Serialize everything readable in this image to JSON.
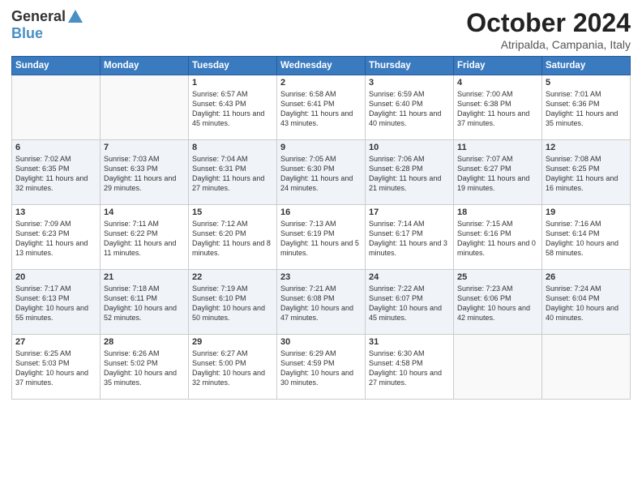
{
  "header": {
    "logo_line1": "General",
    "logo_line2": "Blue",
    "month": "October 2024",
    "location": "Atripalda, Campania, Italy"
  },
  "days_of_week": [
    "Sunday",
    "Monday",
    "Tuesday",
    "Wednesday",
    "Thursday",
    "Friday",
    "Saturday"
  ],
  "weeks": [
    [
      {
        "day": "",
        "content": ""
      },
      {
        "day": "",
        "content": ""
      },
      {
        "day": "1",
        "content": "Sunrise: 6:57 AM\nSunset: 6:43 PM\nDaylight: 11 hours and 45 minutes."
      },
      {
        "day": "2",
        "content": "Sunrise: 6:58 AM\nSunset: 6:41 PM\nDaylight: 11 hours and 43 minutes."
      },
      {
        "day": "3",
        "content": "Sunrise: 6:59 AM\nSunset: 6:40 PM\nDaylight: 11 hours and 40 minutes."
      },
      {
        "day": "4",
        "content": "Sunrise: 7:00 AM\nSunset: 6:38 PM\nDaylight: 11 hours and 37 minutes."
      },
      {
        "day": "5",
        "content": "Sunrise: 7:01 AM\nSunset: 6:36 PM\nDaylight: 11 hours and 35 minutes."
      }
    ],
    [
      {
        "day": "6",
        "content": "Sunrise: 7:02 AM\nSunset: 6:35 PM\nDaylight: 11 hours and 32 minutes."
      },
      {
        "day": "7",
        "content": "Sunrise: 7:03 AM\nSunset: 6:33 PM\nDaylight: 11 hours and 29 minutes."
      },
      {
        "day": "8",
        "content": "Sunrise: 7:04 AM\nSunset: 6:31 PM\nDaylight: 11 hours and 27 minutes."
      },
      {
        "day": "9",
        "content": "Sunrise: 7:05 AM\nSunset: 6:30 PM\nDaylight: 11 hours and 24 minutes."
      },
      {
        "day": "10",
        "content": "Sunrise: 7:06 AM\nSunset: 6:28 PM\nDaylight: 11 hours and 21 minutes."
      },
      {
        "day": "11",
        "content": "Sunrise: 7:07 AM\nSunset: 6:27 PM\nDaylight: 11 hours and 19 minutes."
      },
      {
        "day": "12",
        "content": "Sunrise: 7:08 AM\nSunset: 6:25 PM\nDaylight: 11 hours and 16 minutes."
      }
    ],
    [
      {
        "day": "13",
        "content": "Sunrise: 7:09 AM\nSunset: 6:23 PM\nDaylight: 11 hours and 13 minutes."
      },
      {
        "day": "14",
        "content": "Sunrise: 7:11 AM\nSunset: 6:22 PM\nDaylight: 11 hours and 11 minutes."
      },
      {
        "day": "15",
        "content": "Sunrise: 7:12 AM\nSunset: 6:20 PM\nDaylight: 11 hours and 8 minutes."
      },
      {
        "day": "16",
        "content": "Sunrise: 7:13 AM\nSunset: 6:19 PM\nDaylight: 11 hours and 5 minutes."
      },
      {
        "day": "17",
        "content": "Sunrise: 7:14 AM\nSunset: 6:17 PM\nDaylight: 11 hours and 3 minutes."
      },
      {
        "day": "18",
        "content": "Sunrise: 7:15 AM\nSunset: 6:16 PM\nDaylight: 11 hours and 0 minutes."
      },
      {
        "day": "19",
        "content": "Sunrise: 7:16 AM\nSunset: 6:14 PM\nDaylight: 10 hours and 58 minutes."
      }
    ],
    [
      {
        "day": "20",
        "content": "Sunrise: 7:17 AM\nSunset: 6:13 PM\nDaylight: 10 hours and 55 minutes."
      },
      {
        "day": "21",
        "content": "Sunrise: 7:18 AM\nSunset: 6:11 PM\nDaylight: 10 hours and 52 minutes."
      },
      {
        "day": "22",
        "content": "Sunrise: 7:19 AM\nSunset: 6:10 PM\nDaylight: 10 hours and 50 minutes."
      },
      {
        "day": "23",
        "content": "Sunrise: 7:21 AM\nSunset: 6:08 PM\nDaylight: 10 hours and 47 minutes."
      },
      {
        "day": "24",
        "content": "Sunrise: 7:22 AM\nSunset: 6:07 PM\nDaylight: 10 hours and 45 minutes."
      },
      {
        "day": "25",
        "content": "Sunrise: 7:23 AM\nSunset: 6:06 PM\nDaylight: 10 hours and 42 minutes."
      },
      {
        "day": "26",
        "content": "Sunrise: 7:24 AM\nSunset: 6:04 PM\nDaylight: 10 hours and 40 minutes."
      }
    ],
    [
      {
        "day": "27",
        "content": "Sunrise: 6:25 AM\nSunset: 5:03 PM\nDaylight: 10 hours and 37 minutes."
      },
      {
        "day": "28",
        "content": "Sunrise: 6:26 AM\nSunset: 5:02 PM\nDaylight: 10 hours and 35 minutes."
      },
      {
        "day": "29",
        "content": "Sunrise: 6:27 AM\nSunset: 5:00 PM\nDaylight: 10 hours and 32 minutes."
      },
      {
        "day": "30",
        "content": "Sunrise: 6:29 AM\nSunset: 4:59 PM\nDaylight: 10 hours and 30 minutes."
      },
      {
        "day": "31",
        "content": "Sunrise: 6:30 AM\nSunset: 4:58 PM\nDaylight: 10 hours and 27 minutes."
      },
      {
        "day": "",
        "content": ""
      },
      {
        "day": "",
        "content": ""
      }
    ]
  ]
}
